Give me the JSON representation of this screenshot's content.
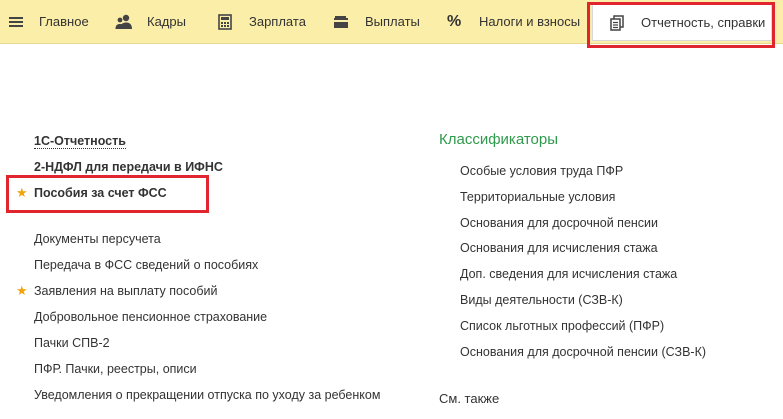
{
  "nav": {
    "items": [
      {
        "label": "Главное",
        "icon": "menu-icon"
      },
      {
        "label": "Кадры",
        "icon": "people-icon"
      },
      {
        "label": "Зарплата",
        "icon": "calculator-icon"
      },
      {
        "label": "Выплаты",
        "icon": "wallet-icon"
      },
      {
        "label": "Налоги и взносы",
        "icon": "percent-icon"
      },
      {
        "label": "Отчетность, справки",
        "icon": "documents-icon"
      }
    ],
    "percent_glyph": "%"
  },
  "left_column": {
    "items": [
      {
        "label": "1С-Отчетность",
        "bold": true,
        "starred": false
      },
      {
        "label": "2-НДФЛ для передачи в ИФНС",
        "bold": true,
        "starred": false
      },
      {
        "label": "Пособия за счет ФСС",
        "bold": true,
        "starred": true
      },
      {
        "label": "Документы персучета",
        "bold": false,
        "starred": false
      },
      {
        "label": "Передача в ФСС сведений о пособиях",
        "bold": false,
        "starred": false
      },
      {
        "label": "Заявления на выплату пособий",
        "bold": false,
        "starred": true
      },
      {
        "label": "Добровольное пенсионное страхование",
        "bold": false,
        "starred": false
      },
      {
        "label": "Пачки СПВ-2",
        "bold": false,
        "starred": false
      },
      {
        "label": "ПФР. Пачки, реестры, описи",
        "bold": false,
        "starred": false
      },
      {
        "label": "Уведомления о прекращении отпуска по уходу за ребенком",
        "bold": false,
        "starred": false
      }
    ],
    "star_glyph": "★"
  },
  "right_column": {
    "title": "Классификаторы",
    "items": [
      "Особые условия труда ПФР",
      "Территориальные условия",
      "Основания для досрочной пенсии",
      "Основания для исчисления стажа",
      "Доп. сведения для исчисления стажа",
      "Виды деятельности (СЗВ-К)",
      "Список льготных профессий (ПФР)",
      "Основания для досрочной пенсии (СЗВ-К)"
    ],
    "see_also": "См. также"
  },
  "colors": {
    "topbar": "#fbeea8",
    "highlight": "#e0252f",
    "section_title": "#2f9a4c",
    "star": "#f0a30a"
  }
}
